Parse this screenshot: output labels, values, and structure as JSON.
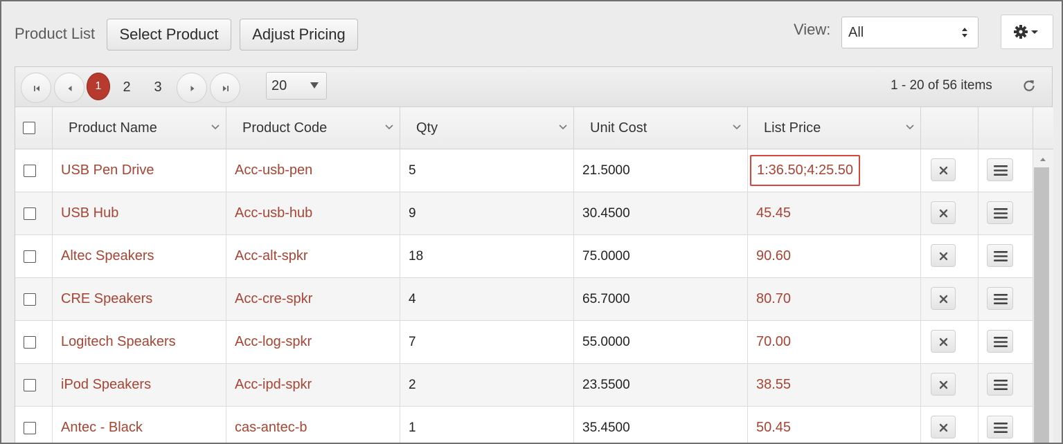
{
  "toolbar": {
    "title": "Product List",
    "select_product": "Select Product",
    "adjust_pricing": "Adjust Pricing",
    "view_label": "View:",
    "view_value": "All",
    "settings_icon": "gear-icon"
  },
  "pager": {
    "pages": [
      "1",
      "2",
      "3"
    ],
    "current_page": "1",
    "page_size": "20",
    "info": "1 - 20 of 56 items"
  },
  "columns": {
    "product_name": "Product Name",
    "product_code": "Product Code",
    "qty": "Qty",
    "unit_cost": "Unit Cost",
    "list_price": "List Price"
  },
  "rows": [
    {
      "name": "USB Pen Drive",
      "code": "Acc-usb-pen",
      "qty": "5",
      "unit_cost": "21.5000",
      "list_price": "1:36.50;4:25.50",
      "highlighted": true
    },
    {
      "name": "USB Hub",
      "code": "Acc-usb-hub",
      "qty": "9",
      "unit_cost": "30.4500",
      "list_price": "45.45"
    },
    {
      "name": "Altec Speakers",
      "code": "Acc-alt-spkr",
      "qty": "18",
      "unit_cost": "75.0000",
      "list_price": "90.60"
    },
    {
      "name": "CRE Speakers",
      "code": "Acc-cre-spkr",
      "qty": "4",
      "unit_cost": "65.7000",
      "list_price": "80.70"
    },
    {
      "name": "Logitech Speakers",
      "code": "Acc-log-spkr",
      "qty": "7",
      "unit_cost": "55.0000",
      "list_price": "70.00"
    },
    {
      "name": "iPod Speakers",
      "code": "Acc-ipd-spkr",
      "qty": "2",
      "unit_cost": "23.5500",
      "list_price": "38.55"
    },
    {
      "name": "Antec - Black",
      "code": "cas-antec-b",
      "qty": "1",
      "unit_cost": "35.4500",
      "list_price": "50.45"
    }
  ],
  "colors": {
    "link": "#a84433",
    "active_page": "#b73a2e",
    "highlight_border": "#d9453a"
  }
}
